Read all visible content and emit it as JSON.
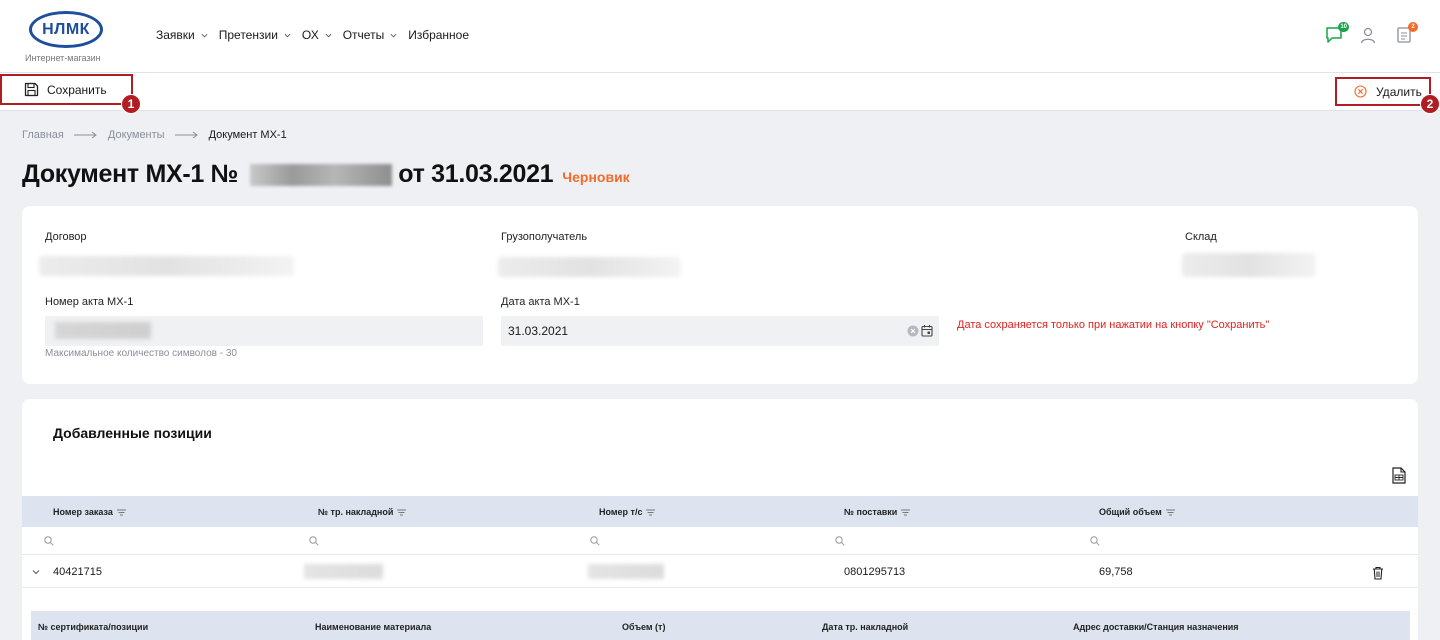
{
  "header": {
    "logo_text": "НЛМК",
    "logo_subtitle": "Интернет-магазин",
    "nav": [
      {
        "label": "Заявки",
        "dropdown": true
      },
      {
        "label": "Претензии",
        "dropdown": true
      },
      {
        "label": "ОХ",
        "dropdown": true
      },
      {
        "label": "Отчеты",
        "dropdown": true
      },
      {
        "label": "Избранное",
        "dropdown": false
      }
    ],
    "chat_badge": "10",
    "docs_badge": "2",
    "colors": {
      "chat": "#17a34a",
      "docs_badge": "#f26b2a",
      "brand": "#1d4f9c"
    }
  },
  "toolbar": {
    "save_label": "Сохранить",
    "delete_label": "Удалить",
    "save_marker": "1",
    "delete_marker": "2"
  },
  "breadcrumb": [
    "Главная",
    "Документы",
    "Документ МХ-1"
  ],
  "page": {
    "title_prefix": "Документ МХ-1 №",
    "title_suffix": "от 31.03.2021",
    "status": "Черновик",
    "status_color": "#f26b2a"
  },
  "form": {
    "contract_label": "Договор",
    "consignee_label": "Грузополучатель",
    "warehouse_label": "Склад",
    "act_number_label": "Номер акта МХ-1",
    "act_number_hint": "Максимальное количество символов - 30",
    "act_date_label": "Дата акта МХ-1",
    "act_date_value": "31.03.2021",
    "date_warning": "Дата сохраняется только при нажатии на кнопку \"Сохранить\""
  },
  "positions": {
    "title": "Добавленные позиции",
    "columns": [
      "Номер заказа",
      "№ тр. накладной",
      "Номер т/с",
      "№ поставки",
      "Общий объем"
    ],
    "rows": [
      {
        "order": "40421715",
        "waybill": "",
        "vehicle": "",
        "delivery": "0801295713",
        "volume": "69,758"
      }
    ],
    "sub_columns": [
      "№ сертификата/позиции",
      "Наименование материала",
      "Объем (т)",
      "Дата тр. накладной",
      "Адрес доставки/Станция назначения"
    ]
  }
}
